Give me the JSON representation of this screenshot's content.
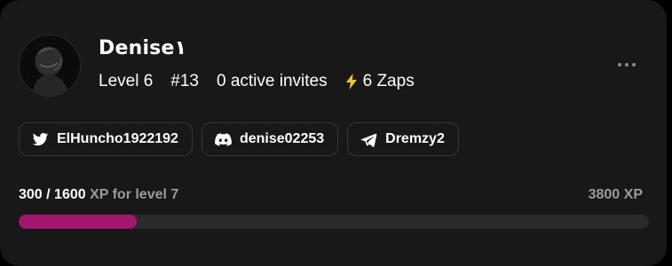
{
  "profile": {
    "username": "Denise١",
    "level_text": "Level 6",
    "rank_text": "#13",
    "invites_text": "0 active invites",
    "zaps_text": "6 Zaps",
    "avatar_icon": "avatar-image",
    "more_icon": "more-horizontal-icon"
  },
  "socials": [
    {
      "platform": "twitter",
      "icon": "twitter-icon",
      "handle": "ElHuncho1922192"
    },
    {
      "platform": "discord",
      "icon": "discord-icon",
      "handle": "denise02253"
    },
    {
      "platform": "telegram",
      "icon": "telegram-icon",
      "handle": "Dremzy2"
    }
  ],
  "xp": {
    "current": "300",
    "separator": " / ",
    "target": "1600",
    "suffix": " XP for level 7",
    "total": "3800 XP",
    "progress_fraction": 0.1875
  },
  "colors": {
    "background": "#181818",
    "accent": "#a4166e",
    "zap": "#f5c518"
  }
}
